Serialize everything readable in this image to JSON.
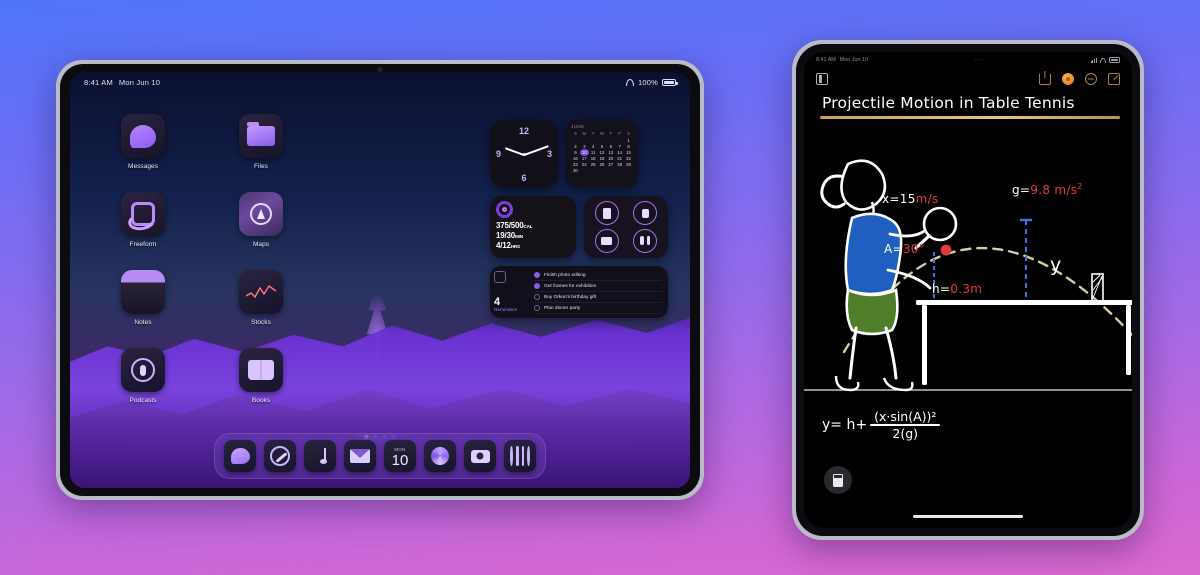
{
  "background": {
    "gradient_from": "#4f74f8",
    "gradient_to": "#dc6ad0"
  },
  "left_device": {
    "name": "iPad landscape home screen",
    "status_bar": {
      "time": "8:41 AM",
      "date": "Mon Jun 10",
      "battery_percent": "100%",
      "wifi_icon": "wifi-icon",
      "battery_icon": "battery-icon"
    },
    "apps": [
      {
        "label": "Messages",
        "icon": "messages-icon"
      },
      {
        "label": "Files",
        "icon": "files-icon"
      },
      {
        "label": "Freeform",
        "icon": "freeform-icon"
      },
      {
        "label": "Maps",
        "icon": "maps-icon"
      },
      {
        "label": "Notes",
        "icon": "notes-icon"
      },
      {
        "label": "Stocks",
        "icon": "stocks-icon"
      },
      {
        "label": "Podcasts",
        "icon": "podcasts-icon"
      },
      {
        "label": "Books",
        "icon": "books-icon"
      }
    ],
    "widgets": {
      "clock": {
        "name": "clock-widget",
        "marks": [
          "12",
          "3",
          "6",
          "9"
        ]
      },
      "calendar": {
        "name": "calendar-widget",
        "month": "JUNE",
        "weekday_headers": [
          "S",
          "M",
          "T",
          "W",
          "T",
          "F",
          "S"
        ],
        "today": "10",
        "weeks": [
          [
            "",
            "",
            "",
            "",
            "",
            "",
            "1"
          ],
          [
            "2",
            "3",
            "4",
            "5",
            "6",
            "7",
            "8"
          ],
          [
            "9",
            "10",
            "11",
            "12",
            "13",
            "14",
            "15"
          ],
          [
            "16",
            "17",
            "18",
            "19",
            "20",
            "21",
            "22"
          ],
          [
            "23",
            "24",
            "25",
            "26",
            "27",
            "28",
            "29"
          ],
          [
            "30",
            "",
            "",
            "",
            "",
            "",
            ""
          ]
        ]
      },
      "fitness": {
        "name": "fitness-widget",
        "move": "375/500",
        "move_unit": "CAL",
        "exercise": "19/30",
        "exercise_unit": "MIN",
        "stand": "4/12",
        "stand_unit": "HRS"
      },
      "batteries": {
        "name": "batteries-widget",
        "devices": [
          "ipad-icon",
          "watch-icon",
          "case-icon",
          "airpods-icon"
        ]
      },
      "reminders": {
        "name": "reminders-widget",
        "count": "4",
        "title": "Reminders",
        "tasks": [
          {
            "text": "Finish photo editing",
            "done": true
          },
          {
            "text": "Get frames for exhibition",
            "done": true
          },
          {
            "text": "Buy Orkun's birthday gift",
            "done": false
          },
          {
            "text": "Plan dinner party",
            "done": false
          }
        ]
      }
    },
    "dock": [
      {
        "label": "Messages",
        "icon": "messages-icon"
      },
      {
        "label": "Safari",
        "icon": "safari-icon"
      },
      {
        "label": "Music",
        "icon": "music-icon"
      },
      {
        "label": "Mail",
        "icon": "mail-icon"
      },
      {
        "label": "Calendar",
        "icon": "calendar-icon",
        "weekday": "MON",
        "day": "10"
      },
      {
        "label": "Photos",
        "icon": "photos-icon"
      },
      {
        "label": "Camera",
        "icon": "camera-icon"
      },
      {
        "label": "App Library",
        "icon": "app-library-icon"
      }
    ],
    "page_dots": 4,
    "active_page": 1
  },
  "right_device": {
    "name": "iPad portrait Notes app",
    "status_bar": {
      "time": "8:41 AM",
      "date": "Mon Jun 10",
      "overflow": "···",
      "signal_icon": "cellular-bars-icon",
      "wifi_icon": "wifi-icon",
      "battery_icon": "battery-icon"
    },
    "toolbar": {
      "sidebar_icon": "sidebar-icon",
      "right_icons": [
        "share-icon",
        "avatar-icon",
        "more-circle-icon",
        "compose-icon"
      ]
    },
    "note": {
      "title": "Projectile Motion in Table Tennis",
      "title_underline_color": "#d8b463",
      "annotations": [
        {
          "name": "velocity-annotation",
          "label": "x=",
          "value": "15",
          "unit": "m/s"
        },
        {
          "name": "gravity-annotation",
          "label": "g=",
          "value": "9.8",
          "unit": "m/s",
          "exponent": "2"
        },
        {
          "name": "angle-annotation",
          "label": "A=",
          "value": "30°"
        },
        {
          "name": "height-annotation",
          "label": "h=",
          "value": "0.3",
          "unit": "m"
        },
        {
          "name": "y-axis-label",
          "label": "y"
        }
      ],
      "formula": {
        "lhs": "y= h+",
        "numerator": "(x·sin(A))²",
        "denominator": "2(g)"
      },
      "colors": {
        "ink": "#ffffff",
        "accent_red": "#e23b3b",
        "trajectory": "#d9cba4",
        "shirt": "#1f5fbf",
        "shorts": "#4f7d2a"
      }
    },
    "tool_button": "calculator-icon",
    "home_indicator": "home-indicator"
  }
}
